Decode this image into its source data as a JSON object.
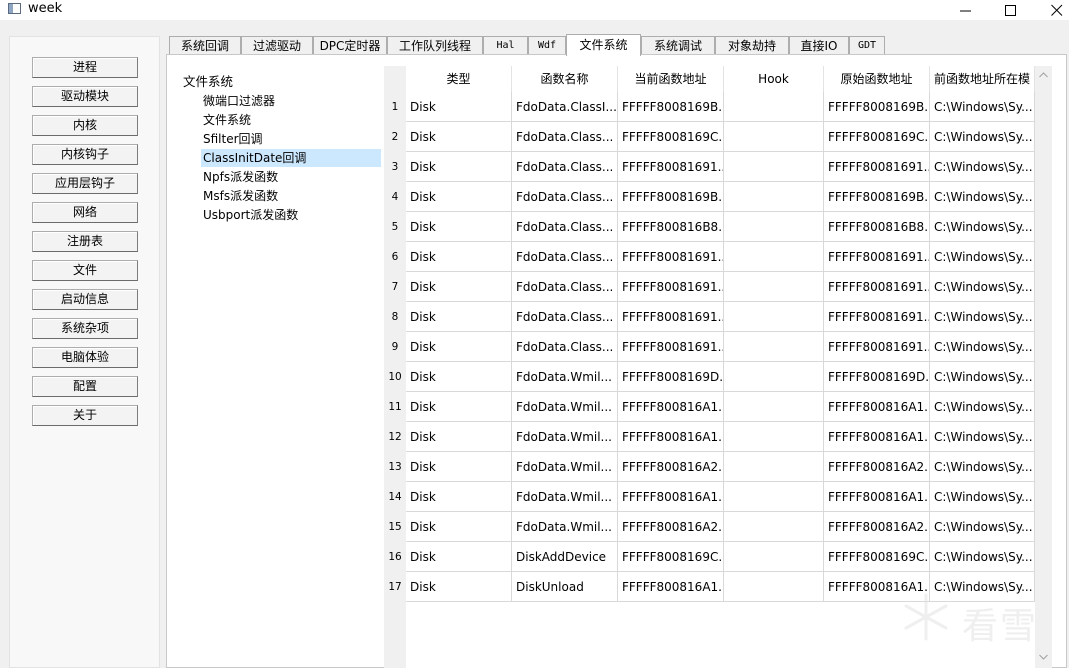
{
  "window": {
    "title": "week"
  },
  "sidebar": {
    "buttons": [
      "进程",
      "驱动模块",
      "内核",
      "内核钩子",
      "应用层钩子",
      "网络",
      "注册表",
      "文件",
      "启动信息",
      "系统杂项",
      "电脑体验",
      "配置",
      "关于"
    ]
  },
  "tabs": [
    "系统回调",
    "过滤驱动",
    "DPC定时器",
    "工作队列线程",
    "Hal",
    "Wdf",
    "文件系统",
    "系统调试",
    "对象劫持",
    "直接IO",
    "GDT"
  ],
  "active_tab": "文件系统",
  "tree": {
    "root": "文件系统",
    "items": [
      "微端口过滤器",
      "文件系统",
      "Sfilter回调",
      "ClassInitDate回调",
      "Npfs派发函数",
      "Msfs派发函数",
      "Usbport派发函数"
    ],
    "selected": "ClassInitDate回调"
  },
  "table": {
    "columns": [
      "类型",
      "函数名称",
      "当前函数地址",
      "Hook",
      "原始函数地址",
      "前函数地址所在模"
    ],
    "rows": [
      [
        "1",
        "Disk",
        "FdoData.ClassI...",
        "FFFFF8008169B...",
        "",
        "FFFFF8008169B...",
        "C:\\Windows\\Sy..."
      ],
      [
        "2",
        "Disk",
        "FdoData.Class...",
        "FFFFF8008169C...",
        "",
        "FFFFF8008169C...",
        "C:\\Windows\\Sy..."
      ],
      [
        "3",
        "Disk",
        "FdoData.Class...",
        "FFFFF80081691...",
        "",
        "FFFFF80081691...",
        "C:\\Windows\\Sy..."
      ],
      [
        "4",
        "Disk",
        "FdoData.Class...",
        "FFFFF8008169B...",
        "",
        "FFFFF8008169B...",
        "C:\\Windows\\Sy..."
      ],
      [
        "5",
        "Disk",
        "FdoData.Class...",
        "FFFFF800816B8...",
        "",
        "FFFFF800816B8...",
        "C:\\Windows\\Sy..."
      ],
      [
        "6",
        "Disk",
        "FdoData.Class...",
        "FFFFF80081691...",
        "",
        "FFFFF80081691...",
        "C:\\Windows\\Sy..."
      ],
      [
        "7",
        "Disk",
        "FdoData.Class...",
        "FFFFF80081691...",
        "",
        "FFFFF80081691...",
        "C:\\Windows\\Sy..."
      ],
      [
        "8",
        "Disk",
        "FdoData.Class...",
        "FFFFF80081691...",
        "",
        "FFFFF80081691...",
        "C:\\Windows\\Sy..."
      ],
      [
        "9",
        "Disk",
        "FdoData.Class...",
        "FFFFF80081691...",
        "",
        "FFFFF80081691...",
        "C:\\Windows\\Sy..."
      ],
      [
        "10",
        "Disk",
        "FdoData.Wmil...",
        "FFFFF8008169D...",
        "",
        "FFFFF8008169D...",
        "C:\\Windows\\Sy..."
      ],
      [
        "11",
        "Disk",
        "FdoData.Wmil...",
        "FFFFF800816A1...",
        "",
        "FFFFF800816A1...",
        "C:\\Windows\\Sy..."
      ],
      [
        "12",
        "Disk",
        "FdoData.Wmil...",
        "FFFFF800816A1...",
        "",
        "FFFFF800816A1...",
        "C:\\Windows\\Sy..."
      ],
      [
        "13",
        "Disk",
        "FdoData.Wmil...",
        "FFFFF800816A2...",
        "",
        "FFFFF800816A2...",
        "C:\\Windows\\Sy..."
      ],
      [
        "14",
        "Disk",
        "FdoData.Wmil...",
        "FFFFF800816A1...",
        "",
        "FFFFF800816A1...",
        "C:\\Windows\\Sy..."
      ],
      [
        "15",
        "Disk",
        "FdoData.Wmil...",
        "FFFFF800816A2...",
        "",
        "FFFFF800816A2...",
        "C:\\Windows\\Sy..."
      ],
      [
        "16",
        "Disk",
        "DiskAddDevice",
        "FFFFF8008169C...",
        "",
        "FFFFF8008169C...",
        "C:\\Windows\\Sy..."
      ],
      [
        "17",
        "Disk",
        "DiskUnload",
        "FFFFF800816A1...",
        "",
        "FFFFF800816A1...",
        "C:\\Windows\\Sy..."
      ]
    ]
  },
  "watermark": {
    "text": "看雪"
  },
  "colors": {
    "selection": "#cce8ff",
    "border": "#adadad"
  }
}
